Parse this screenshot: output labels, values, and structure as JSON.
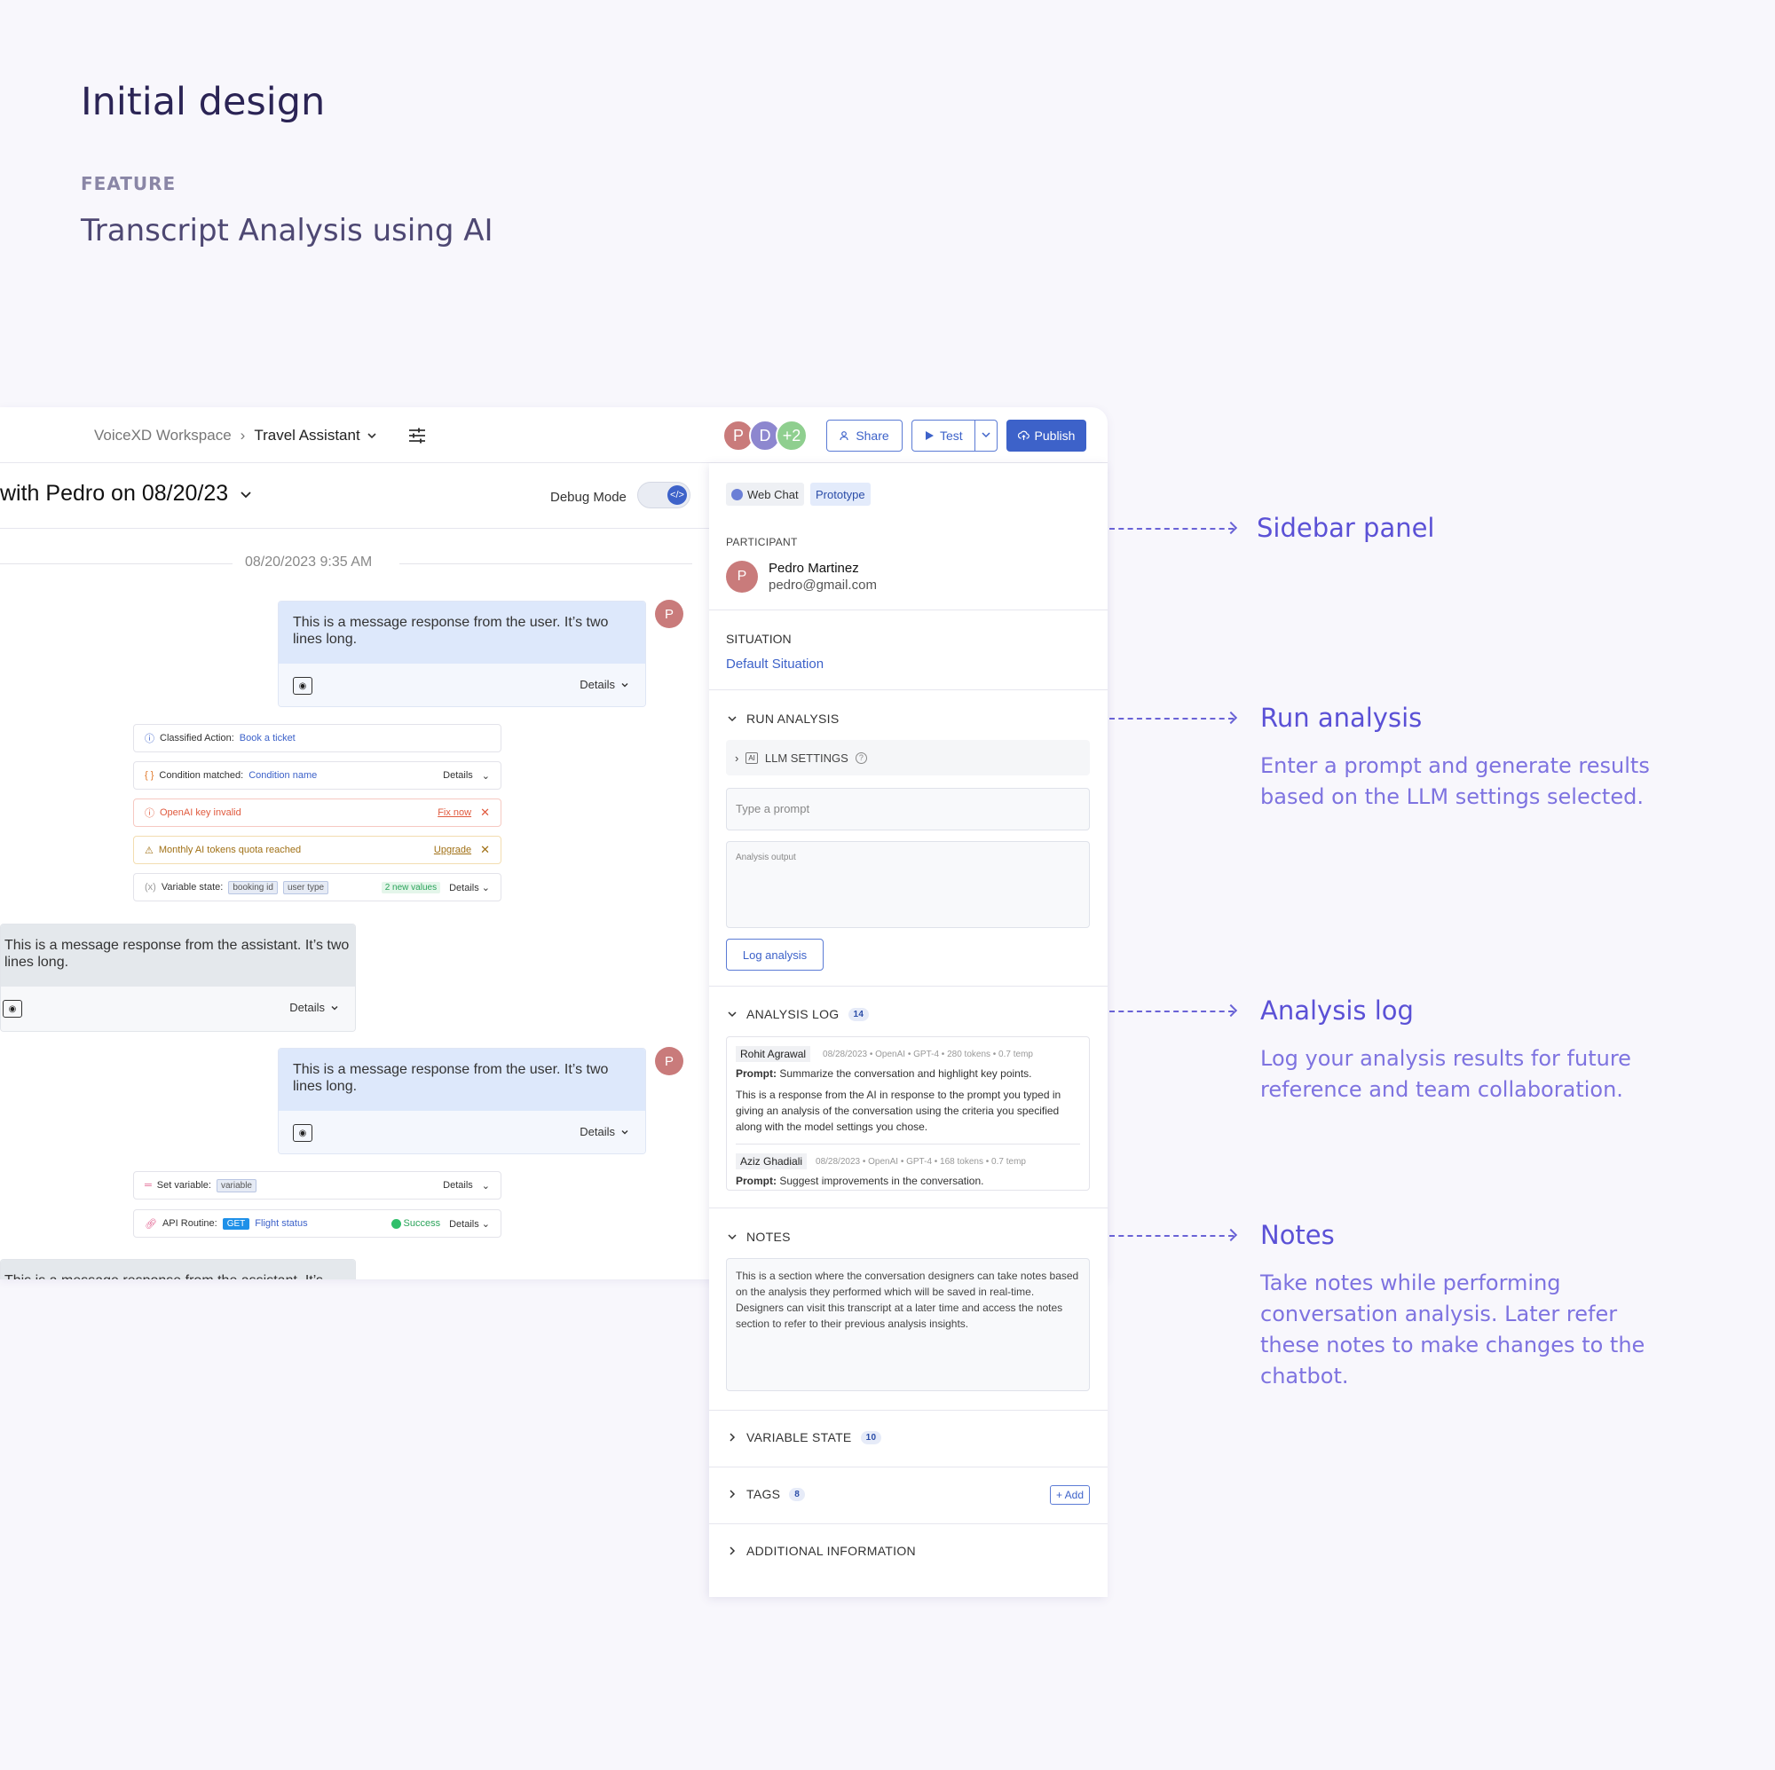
{
  "header": {
    "title": "Initial design",
    "feature_label": "FEATURE",
    "subtitle": "Transcript Analysis using AI"
  },
  "topbar": {
    "workspace": "VoiceXD Workspace",
    "project": "Travel Assistant",
    "avatars": [
      {
        "initial": "P",
        "color": "#c97b7b"
      },
      {
        "initial": "D",
        "color": "#8d87cf"
      },
      {
        "initial": "+2",
        "color": "#8fcf8f"
      }
    ],
    "share_label": "Share",
    "test_label": "Test",
    "publish_label": "Publish"
  },
  "conversation": {
    "title": "with Pedro on 08/20/23",
    "debug_label": "Debug Mode",
    "date": "08/20/2023 9:35 AM",
    "user_message": "This is a message response from the user. It’s two lines long.",
    "assistant_message": "This is a message response from the assistant. It’s two lines long.",
    "assistant_truncated": "This is a message response from the assistant. It’s",
    "details_label": "Details",
    "user_initial": "P",
    "events": {
      "classified_label": "Classified Action:",
      "classified_value": "Book a ticket",
      "condition_label": "Condition matched:",
      "condition_value": "Condition name",
      "openai_error": "OpenAI key invalid",
      "fix_now": "Fix now",
      "quota_warning": "Monthly AI tokens quota reached",
      "upgrade": "Upgrade",
      "variable_state_label": "Variable state:",
      "var_chip1": "booking id",
      "var_chip2": "user type",
      "new_values": "2 new values",
      "set_variable_label": "Set variable:",
      "set_variable_chip": "variable",
      "api_label": "API Routine:",
      "api_method": "GET",
      "api_name": "Flight status",
      "api_status": "Success"
    }
  },
  "sidebar": {
    "channel": "Web Chat",
    "mode": "Prototype",
    "participant_label": "PARTICIPANT",
    "participant_initial": "P",
    "participant_name": "Pedro Martinez",
    "participant_email": "pedro@gmail.com",
    "situation_label": "SITUATION",
    "situation_value": "Default Situation",
    "run_analysis_label": "RUN ANALYSIS",
    "llm_settings_label": "LLM SETTINGS",
    "prompt_placeholder": "Type a prompt",
    "output_placeholder": "Analysis output",
    "log_button": "Log analysis",
    "analysis_log_label": "ANALYSIS LOG",
    "analysis_log_count": "14",
    "log_entries": [
      {
        "author": "Rohit Agrawal",
        "meta": "08/28/2023 • OpenAI • GPT-4 • 280 tokens • 0.7 temp",
        "prompt_label": "Prompt:",
        "prompt": "Summarize the conversation and highlight key points.",
        "response": "This is a response from the AI in response to the prompt you typed in giving an analysis of the conversation using the criteria you specified along with the model settings you chose."
      },
      {
        "author": "Aziz Ghadiali",
        "meta": "08/28/2023 • OpenAI • GPT-4 • 168 tokens • 0.7 temp",
        "prompt_label": "Prompt:",
        "prompt": "Suggest improvements in the conversation."
      }
    ],
    "notes_label": "NOTES",
    "notes_text": "This is a section where the conversation designers can take notes based on the analysis they performed which will be saved in real-time. Designers can visit this transcript at a later time and access the notes section to refer to their previous analysis insights.",
    "variable_state_label": "VARIABLE STATE",
    "variable_state_count": "10",
    "tags_label": "TAGS",
    "tags_count": "8",
    "add_label": "+ Add",
    "additional_label": "ADDITIONAL INFORMATION"
  },
  "annotations": {
    "sidebar_panel": "Sidebar panel",
    "run_analysis_title": "Run analysis",
    "run_analysis_desc": "Enter a prompt and generate results based on the LLM settings selected.",
    "analysis_log_title": "Analysis log",
    "analysis_log_desc": "Log your analysis results for future reference and team collaboration.",
    "notes_title": "Notes",
    "notes_desc": "Take notes while performing conversation analysis. Later refer these notes to make changes to the chatbot."
  }
}
